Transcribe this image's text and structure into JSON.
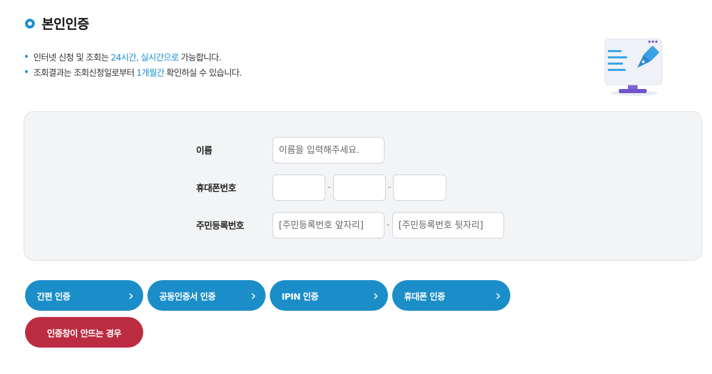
{
  "section": {
    "title": "본인인증"
  },
  "notes": [
    {
      "before": "인터넷 신청 및 조회는",
      "highlight": "24시간, 실시간으로",
      "after": "가능합니다."
    },
    {
      "before": "조회결과는 조회신청일로부터",
      "highlight": "1개월간",
      "after": "확인하실 수 있습니다."
    }
  ],
  "form": {
    "name": {
      "label": "이름",
      "value": "",
      "placeholder": "이름을 입력해주세요."
    },
    "phone": {
      "label": "휴대폰번호",
      "part1": "",
      "part2": "",
      "part3": "",
      "separator": "-"
    },
    "rrn": {
      "label": "주민등록번호",
      "front_placeholder": "[주민등록번호 앞자리]",
      "back_placeholder": "[주민등록번호 뒷자리]",
      "separator": "-"
    }
  },
  "buttons": {
    "simple_auth": "간편 인증",
    "cert_auth": "공동인증서 인증",
    "ipin_auth": "IPIN 인증",
    "phone_auth": "휴대폰 인증",
    "help": "인증창이 안뜨는 경우",
    "chevron": "›"
  },
  "colors": {
    "accent": "#1b8ec9",
    "danger": "#bc2c40",
    "panel_bg": "#f2f4f6"
  },
  "icons": {
    "title": "ring-icon",
    "illustration": "monitor-pen-icon"
  }
}
